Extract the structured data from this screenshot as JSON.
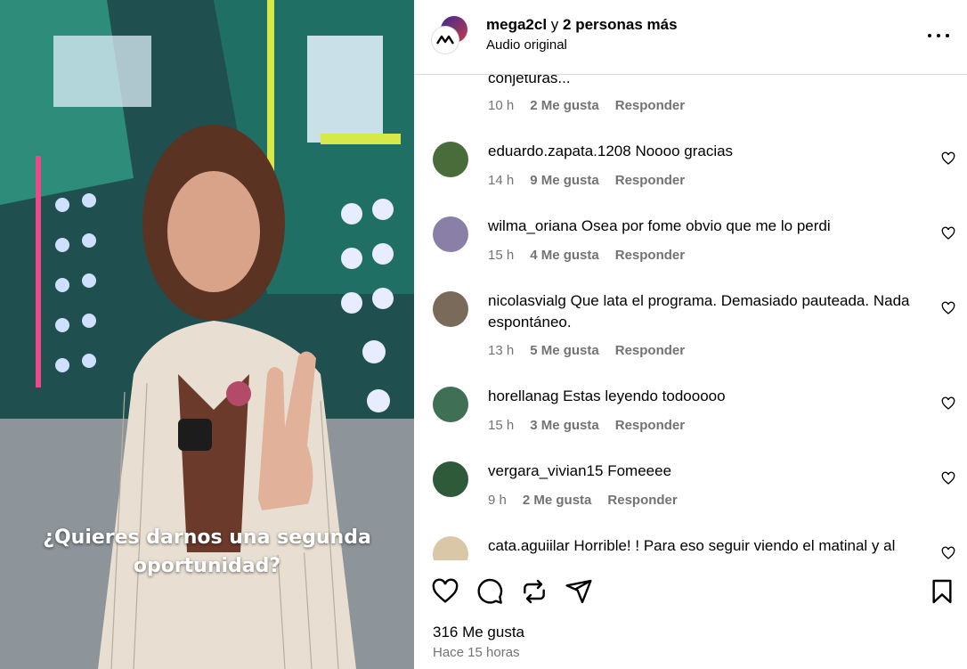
{
  "media": {
    "caption_line1": "¿Quieres darnos una segunda",
    "caption_line2": "oportunidad?"
  },
  "header": {
    "account": "mega2cl",
    "connector": "y",
    "others": "2 personas más",
    "audio": "Audio original",
    "more_icon": "more-horizontal-icon"
  },
  "comments": [
    {
      "user": "",
      "text": "conjeturas...",
      "time": "10 h",
      "likes": "2 Me gusta",
      "reply": "Responder",
      "avatar_color": ""
    },
    {
      "user": "eduardo.zapata.1208",
      "text": "Noooo gracias",
      "time": "14 h",
      "likes": "9 Me gusta",
      "reply": "Responder",
      "avatar_color": "#4a6b3a"
    },
    {
      "user": "wilma_oriana",
      "text": "Osea por fome obvio que me lo perdi",
      "time": "15 h",
      "likes": "4 Me gusta",
      "reply": "Responder",
      "avatar_color": "#8a7fa6"
    },
    {
      "user": "nicolasvialg",
      "text": "Que lata el programa. Demasiado pauteada. Nada espontáneo.",
      "time": "13 h",
      "likes": "5 Me gusta",
      "reply": "Responder",
      "avatar_color": "#7a6a5a"
    },
    {
      "user": "horellanag",
      "text": "Estas leyendo todooooo",
      "time": "15 h",
      "likes": "3 Me gusta",
      "reply": "Responder",
      "avatar_color": "#3f6f55"
    },
    {
      "user": "vergara_vivian15",
      "text": "Fomeeee",
      "time": "9 h",
      "likes": "2 Me gusta",
      "reply": "Responder",
      "avatar_color": "#2f5a3a"
    },
    {
      "user": "cata.aguiilar",
      "text": "Horrible! ! Para eso seguir viendo el matinal y al",
      "time": "",
      "likes": "",
      "reply": "",
      "avatar_color": "#d9c7a8"
    }
  ],
  "actions": {
    "like_icon": "heart-icon",
    "comment_icon": "comment-icon",
    "repost_icon": "repost-icon",
    "share_icon": "send-icon",
    "save_icon": "bookmark-icon",
    "likes_count": "316 Me gusta",
    "time_ago": "Hace 15 horas"
  }
}
